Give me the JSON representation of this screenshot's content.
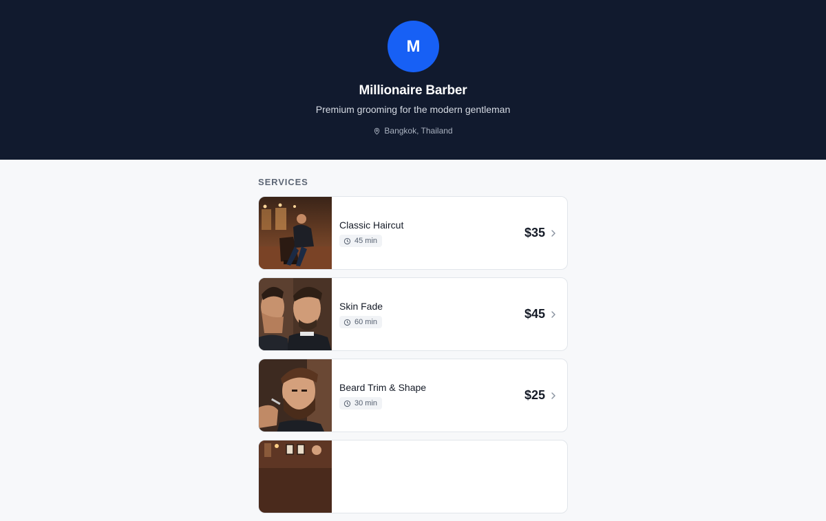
{
  "business": {
    "avatar_initial": "M",
    "name": "Millionaire Barber",
    "tagline": "Premium grooming for the modern gentleman",
    "location": "Bangkok, Thailand"
  },
  "colors": {
    "hero_bg": "#111a2e",
    "avatar_bg": "#1760f5",
    "page_bg": "#f7f8fa"
  },
  "services_section": {
    "title": "SERVICES",
    "items": [
      {
        "name": "Classic Haircut",
        "duration": "45 min",
        "price": "$35",
        "image": "barbershop-chair-photo"
      },
      {
        "name": "Skin Fade",
        "duration": "60 min",
        "price": "$45",
        "image": "skin-fade-photo"
      },
      {
        "name": "Beard Trim & Shape",
        "duration": "30 min",
        "price": "$25",
        "image": "beard-trim-photo"
      },
      {
        "name": "",
        "duration": "",
        "price": "",
        "image": "barbershop-interior-photo"
      }
    ]
  }
}
